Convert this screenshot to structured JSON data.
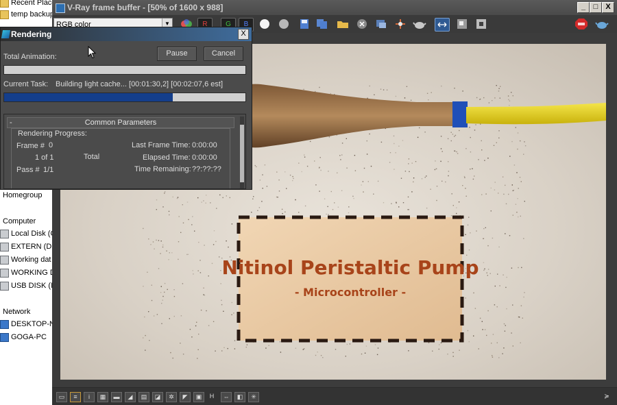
{
  "explorer": {
    "top_items": [
      {
        "label": "Recent Place",
        "icon": "folder-icon"
      },
      {
        "label": "temp backup",
        "icon": "folder-icon"
      }
    ],
    "homegroup": "Homegroup",
    "computer": "Computer",
    "drives": [
      {
        "label": "Local Disk (C",
        "icon": "drive-icon"
      },
      {
        "label": "EXTERN (D:)",
        "icon": "drive-icon"
      },
      {
        "label": "Working dat",
        "icon": "drive-icon"
      },
      {
        "label": "WORKING D",
        "icon": "drive-icon"
      },
      {
        "label": "USB DISK (I:",
        "icon": "drive-icon"
      }
    ],
    "network": "Network",
    "network_items": [
      {
        "label": "DESKTOP-N",
        "icon": "computer-icon"
      },
      {
        "label": "GOGA-PC",
        "icon": "computer-icon"
      }
    ]
  },
  "vfb": {
    "title": "V-Ray frame buffer - [50% of 1600 x 988]",
    "channel": "RGB color",
    "channel_buttons": {
      "r": "R",
      "g": "G",
      "b": "B"
    },
    "window_buttons": {
      "minimize": "_",
      "maximize": "□",
      "close": "X"
    },
    "status_h": "H"
  },
  "render": {
    "sign_title": "Nitinol Peristaltic Pump",
    "sign_subtitle": "- Microcontroller -"
  },
  "dialog": {
    "title": "Rendering",
    "close": "X",
    "total_animation_label": "Total Animation:",
    "pause": "Pause",
    "cancel": "Cancel",
    "total_progress": 0,
    "current_task_label": "Current Task:",
    "current_task": "Building light cache... [00:01:30,2] [00:02:07,6 est]",
    "task_progress": 0.7,
    "rollout_title": "Common Parameters",
    "rollout_toggle": "-",
    "group_label": "Rendering Progress:",
    "frame_label": "Frame #",
    "frame_value": "0",
    "frames_count": "1 of 1",
    "total_label": "Total",
    "pass_label": "Pass #",
    "pass_value": "1/1",
    "last_frame_time_label": "Last Frame Time:",
    "last_frame_time": "0:00:00",
    "elapsed_time_label": "Elapsed Time:",
    "elapsed_time": "0:00:00",
    "time_remaining_label": "Time Remaining:",
    "time_remaining": "??:??:??"
  },
  "colors": {
    "progress_fill": "#143e8b",
    "wood": "#e8c79f",
    "hose": "#e6d21a",
    "cap": "#1f4fb8",
    "sign_text": "#a8441a"
  }
}
